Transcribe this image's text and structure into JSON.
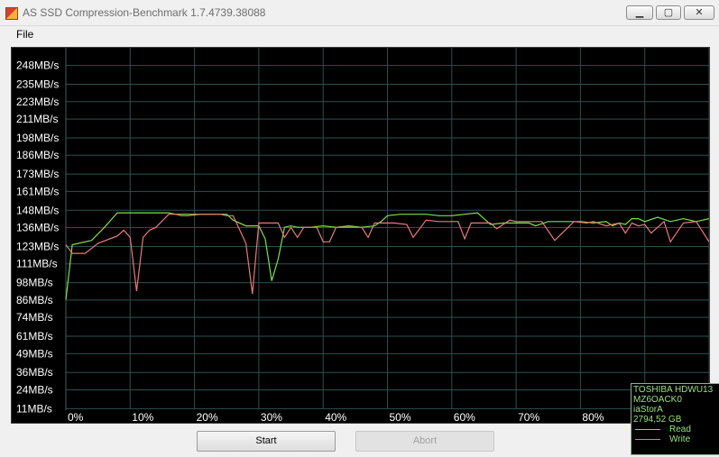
{
  "window": {
    "title": "AS SSD Compression-Benchmark 1.7.4739.38088",
    "controls": {
      "minimize": "▁",
      "maximize": "▢",
      "close": "✕"
    }
  },
  "menu": {
    "file": "File"
  },
  "chart_data": {
    "type": "line",
    "ylim": [
      5,
      254
    ],
    "y_ticks": [
      "248MB/s",
      "235MB/s",
      "223MB/s",
      "211MB/s",
      "198MB/s",
      "186MB/s",
      "173MB/s",
      "161MB/s",
      "148MB/s",
      "136MB/s",
      "123MB/s",
      "111MB/s",
      "98MB/s",
      "86MB/s",
      "74MB/s",
      "61MB/s",
      "49MB/s",
      "36MB/s",
      "24MB/s",
      "11MB/s"
    ],
    "y_tick_values": [
      248,
      235,
      223,
      211,
      198,
      186,
      173,
      161,
      148,
      136,
      123,
      111,
      98,
      86,
      74,
      61,
      49,
      36,
      24,
      11
    ],
    "x_ticks": [
      "0%",
      "10%",
      "20%",
      "30%",
      "40%",
      "50%",
      "60%",
      "70%",
      "80%",
      "90%",
      "100%"
    ],
    "xlim": [
      0,
      100
    ],
    "series": [
      {
        "name": "Read",
        "color": "#7fe04a",
        "x": [
          0,
          1,
          4,
          6,
          8,
          9,
          10,
          12,
          14,
          15,
          16,
          17,
          19,
          21,
          25,
          26,
          28,
          29,
          30,
          31,
          32,
          33,
          34,
          35,
          36,
          38,
          40,
          42,
          44,
          46,
          48,
          49,
          50,
          52,
          54,
          56,
          58,
          60,
          62,
          64,
          65,
          66,
          68,
          70,
          72,
          73,
          75,
          77,
          80,
          82,
          84,
          85,
          86,
          87,
          88,
          89,
          90,
          92,
          94,
          96,
          98,
          100
        ],
        "values": [
          80,
          118,
          121,
          130,
          140,
          140,
          140,
          140,
          140,
          140,
          140,
          139,
          139,
          139,
          139,
          135,
          131,
          131,
          131,
          122,
          93,
          108,
          130,
          131,
          130,
          130,
          131,
          130,
          131,
          130,
          131,
          134,
          138,
          139,
          139,
          139,
          138,
          138,
          139,
          140,
          136,
          132,
          133,
          133,
          133,
          131,
          134,
          134,
          134,
          133,
          134,
          131,
          133,
          132,
          136,
          136,
          134,
          137,
          134,
          136,
          134,
          136
        ]
      },
      {
        "name": "Write",
        "color": "#e87a7a",
        "x": [
          0,
          1,
          3,
          5,
          8,
          9,
          10,
          11,
          12,
          13,
          14,
          16,
          17,
          18,
          19,
          21,
          24,
          25,
          26,
          28,
          29,
          30,
          31,
          32,
          33,
          34,
          35,
          36,
          37,
          39,
          40,
          41,
          42,
          44,
          46,
          47,
          48,
          50,
          51,
          53,
          54,
          56,
          58,
          59,
          61,
          62,
          63,
          64,
          66,
          67,
          69,
          70,
          72,
          74,
          76,
          79,
          81,
          82,
          84,
          86,
          87,
          88,
          89,
          90,
          91,
          93,
          94,
          96,
          98,
          100
        ],
        "values": [
          118,
          112,
          112,
          119,
          124,
          128,
          123,
          86,
          123,
          128,
          130,
          139,
          139,
          138,
          138,
          139,
          139,
          138,
          138,
          119,
          84,
          133,
          133,
          133,
          133,
          123,
          130,
          123,
          130,
          130,
          120,
          120,
          130,
          130,
          130,
          123,
          133,
          133,
          133,
          132,
          123,
          135,
          134,
          134,
          134,
          122,
          133,
          133,
          133,
          129,
          135,
          134,
          134,
          134,
          121,
          134,
          133,
          134,
          131,
          133,
          126,
          133,
          131,
          132,
          126,
          134,
          120,
          133,
          134,
          120
        ]
      }
    ],
    "legend": {
      "placement": "bottom-right",
      "drive_lines": [
        "TOSHIBA HDWU13",
        "MZ6OACK0",
        "iaStorA",
        "2794,52 GB"
      ],
      "entries": [
        "Read",
        "Write"
      ]
    },
    "grid": true
  },
  "buttons": {
    "start": "Start",
    "abort": "Abort"
  }
}
